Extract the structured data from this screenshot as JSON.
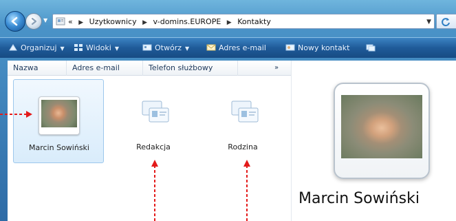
{
  "address_bar": {
    "crumbs": [
      "«",
      "Uzytkownicy",
      "v-domins.EUROPE",
      "Kontakty"
    ]
  },
  "toolbar": {
    "items": [
      {
        "label": "Organizuj",
        "icon": "organize-icon",
        "dropdown": true
      },
      {
        "label": "Widoki",
        "icon": "views-icon",
        "dropdown": true
      },
      {
        "label": "Otwórz",
        "icon": "open-icon",
        "dropdown": true
      },
      {
        "label": "Adres e-mail",
        "icon": "email-icon",
        "dropdown": false
      },
      {
        "label": "Nowy kontakt",
        "icon": "new-contact-icon",
        "dropdown": false
      }
    ]
  },
  "columns": {
    "name": "Nazwa",
    "email": "Adres e-mail",
    "phone": "Telefon służbowy",
    "more": "»"
  },
  "items": [
    {
      "label": "Marcin Sowiński",
      "type": "contact",
      "selected": true
    },
    {
      "label": "Redakcja",
      "type": "group",
      "selected": false
    },
    {
      "label": "Rodzina",
      "type": "group",
      "selected": false
    }
  ],
  "preview": {
    "name": "Marcin Sowiński"
  },
  "colors": {
    "annotation": "#e31a1a",
    "selection": "#d9ecfb"
  }
}
